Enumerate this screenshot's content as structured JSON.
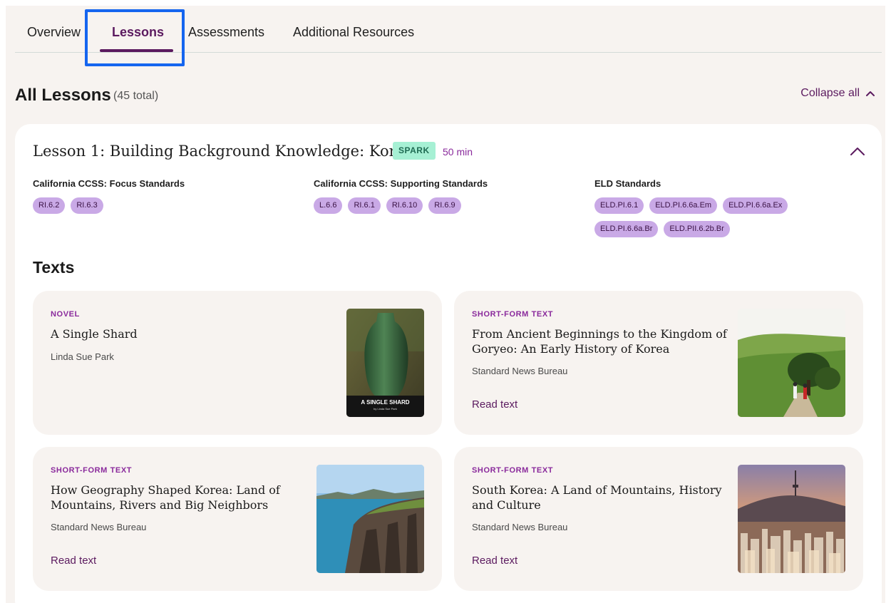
{
  "tabs": [
    {
      "label": "Overview",
      "active": false
    },
    {
      "label": "Lessons",
      "active": true
    },
    {
      "label": "Assessments",
      "active": false
    },
    {
      "label": "Additional Resources",
      "active": false
    }
  ],
  "header": {
    "title": "All Lessons",
    "total": "(45 total)",
    "collapse_label": "Collapse all"
  },
  "lesson": {
    "title": "Lesson 1: Building Background Knowledge: Korea",
    "badge": "SPARK",
    "duration": "50 min",
    "standards": [
      {
        "heading": "California CCSS: Focus Standards",
        "chips": [
          "RI.6.2",
          "RI.6.3"
        ]
      },
      {
        "heading": "California CCSS: Supporting Standards",
        "chips": [
          "L.6.6",
          "RI.6.1",
          "RI.6.10",
          "RI.6.9"
        ]
      },
      {
        "heading": "ELD Standards",
        "chips": [
          "ELD.PI.6.1",
          "ELD.PI.6.6a.Em",
          "ELD.PI.6.6a.Ex",
          "ELD.PI.6.6a.Br",
          "ELD.PII.6.2b.Br"
        ]
      }
    ],
    "texts_heading": "Texts",
    "texts": [
      {
        "type": "NOVEL",
        "title_lines": [
          "A Single Shard"
        ],
        "author": "Linda Sue Park",
        "link": "",
        "cover_title": "A SINGLE SHARD",
        "cover_sub": "by Linda Sue Park"
      },
      {
        "type": "SHORT-FORM TEXT",
        "title_lines": [
          "From Ancient Beginnings to the Kingdom of",
          "Goryeo: An Early History of Korea"
        ],
        "author": "Standard News Bureau",
        "link": "Read text"
      },
      {
        "type": "SHORT-FORM TEXT",
        "title_lines": [
          "How Geography Shaped Korea: Land of",
          "Mountains, Rivers and Big Neighbors"
        ],
        "author": "Standard News Bureau",
        "link": "Read text"
      },
      {
        "type": "SHORT-FORM TEXT",
        "title_lines": [
          "South Korea: A Land of Mountains, History",
          "and Culture"
        ],
        "author": "Standard News Bureau",
        "link": "Read text"
      }
    ]
  },
  "colors": {
    "accent": "#5b1a5f",
    "chip": "#c9a9e6",
    "spark": "#a6f0d4",
    "highlight": "#1565ef"
  }
}
